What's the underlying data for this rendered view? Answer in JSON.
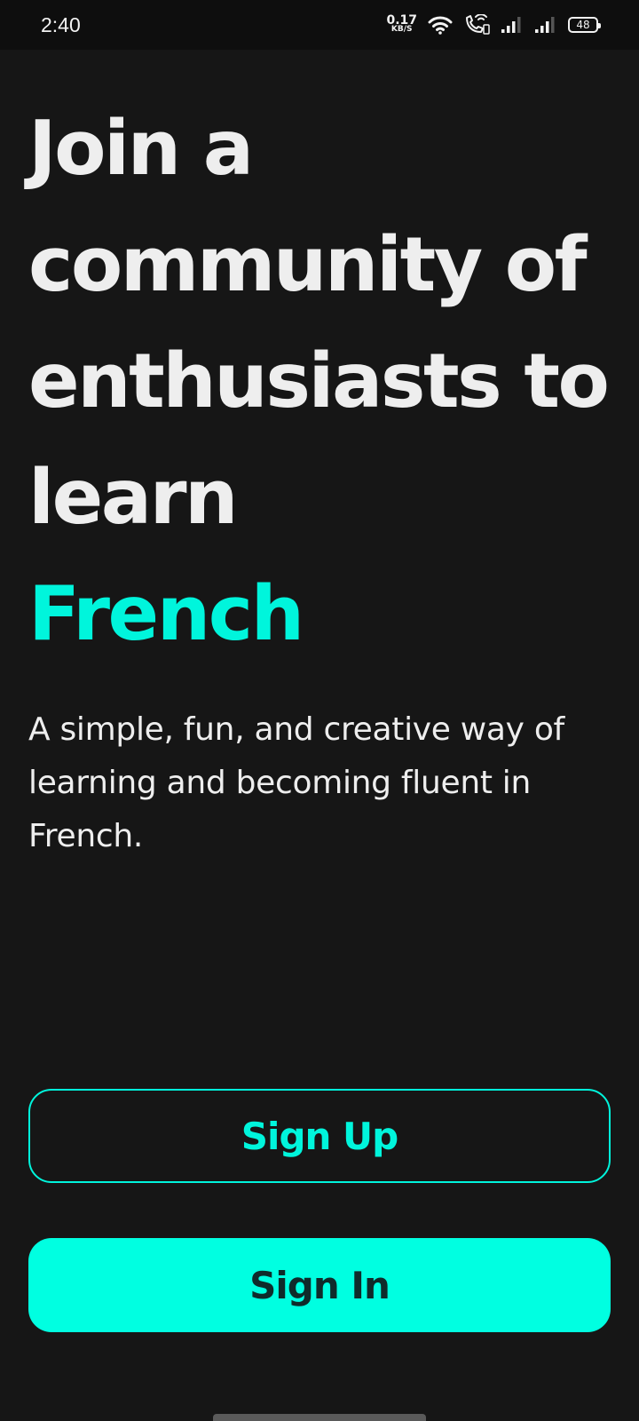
{
  "status_bar": {
    "time": "2:40",
    "net_speed_value": "0.17",
    "net_speed_unit": "KB/S",
    "battery_level": "48",
    "icons": [
      "wifi-icon",
      "vowifi-call-icon",
      "signal-sim1-icon",
      "signal-sim2-icon",
      "battery-icon"
    ]
  },
  "hero": {
    "headline_lines": [
      "Join a",
      "community of",
      "enthusiasts to",
      "learn"
    ],
    "headline_accent": "French",
    "subtitle": "A simple, fun, and creative way of learning and becoming fluent in French."
  },
  "actions": {
    "sign_up_label": "Sign Up",
    "sign_in_label": "Sign In"
  },
  "colors": {
    "background": "#161616",
    "accent": "#00f5dc",
    "button_fill": "#00ffe1",
    "button_fill_text": "#0f2b2b",
    "text": "#eeeeee"
  }
}
